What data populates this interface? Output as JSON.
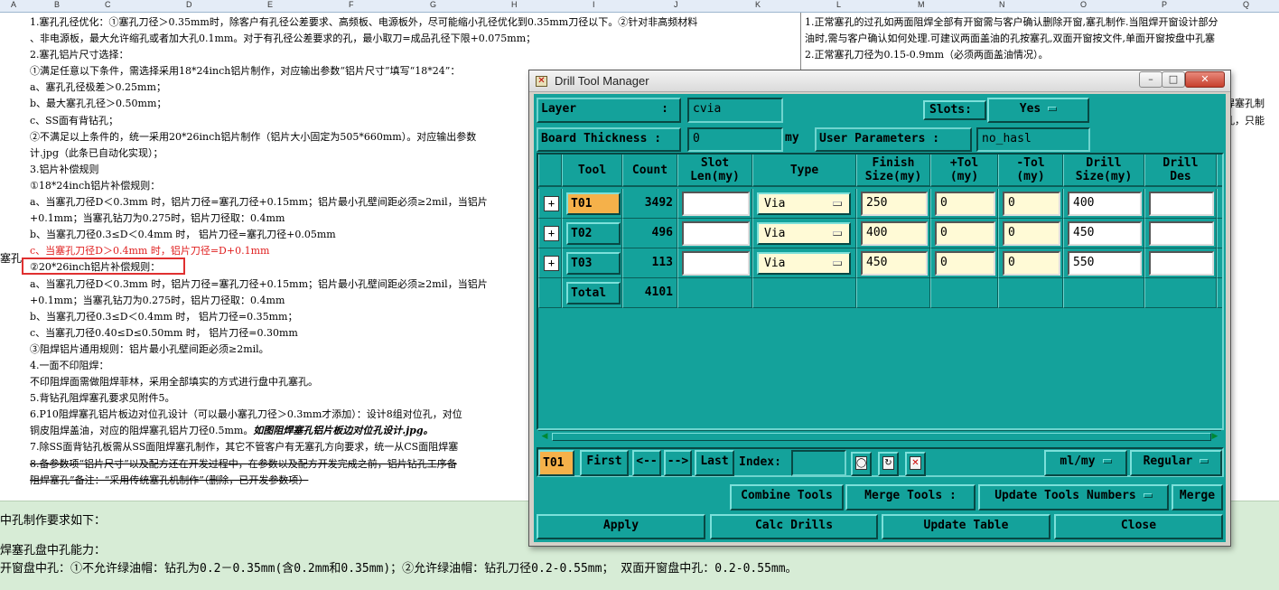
{
  "spreadsheet": {
    "columns": [
      "A",
      "B",
      "C",
      "D",
      "E",
      "F",
      "G",
      "H",
      "I",
      "J",
      "K",
      "L",
      "M",
      "N",
      "O",
      "P",
      "Q"
    ],
    "row_label": "塞孔",
    "left_cell": [
      {
        "text": "1.塞孔孔径优化：①塞孔刀径＞0.35mm时，除客户有孔径公差要求、高频板、电源板外，尽可能缩小孔径优化到0.35mm刀径以下。②针对非高频材料",
        "style": ""
      },
      {
        "text": "、非电源板，最大允许缩孔或者加大孔0.1mm。对于有孔径公差要求的孔，最小取刀=成品孔径下限+0.075mm；",
        "style": ""
      },
      {
        "text": "2.塞孔铝片尺寸选择：",
        "style": ""
      },
      {
        "text": "①满足任意以下条件，需选择采用18*24inch铝片制作，对应输出参数“铝片尺寸”填写“18*24”：",
        "style": ""
      },
      {
        "text": "a、塞孔孔径极差＞0.25mm；",
        "style": ""
      },
      {
        "text": "b、最大塞孔孔径＞0.50mm；",
        "style": ""
      },
      {
        "text": "c、SS面有背钻孔；",
        "style": ""
      },
      {
        "text": "②不满足以上条件的，统一采用20*26inch铝片制作（铝片大小固定为505*660mm）。对应输出参数",
        "style": ""
      },
      {
        "text": "计.jpg（此条已自动化实现）；",
        "style": ""
      },
      {
        "text": "3.铝片补偿规则",
        "style": ""
      },
      {
        "text": "①18*24inch铝片补偿规则：",
        "style": ""
      },
      {
        "text": "a、当塞孔刀径D＜0.3mm 时，铝片刀径=塞孔刀径+0.15mm；铝片最小孔壁间距必须≥2mil，当铝片",
        "style": ""
      },
      {
        "text": "+0.1mm；当塞孔钻刀为0.275时，铝片刀径取：0.4mm",
        "style": ""
      },
      {
        "text": "b、当塞孔刀径0.3≤D＜0.4mm 时， 铝片刀径=塞孔刀径+0.05mm",
        "style": ""
      },
      {
        "text": "c、当塞孔刀径D＞0.4mm 时，铝片刀径=D+0.1mm",
        "style": "red"
      },
      {
        "text": "②20*26inch铝片补偿规则：",
        "style": ""
      },
      {
        "text": "a、当塞孔刀径D＜0.3mm 时，铝片刀径=塞孔刀径+0.15mm；铝片最小孔壁间距必须≥2mil，当铝片",
        "style": ""
      },
      {
        "text": "+0.1mm；当塞孔钻刀为0.275时，铝片刀径取：0.4mm",
        "style": ""
      },
      {
        "text": "b、当塞孔刀径0.3≤D＜0.4mm 时， 铝片刀径=0.35mm；",
        "style": ""
      },
      {
        "text": "c、当塞孔刀径0.40≤D≤0.50mm 时， 铝片刀径=0.30mm",
        "style": ""
      },
      {
        "text": "③阻焊铝片通用规则：铝片最小孔壁间距必须≥2mil。",
        "style": ""
      },
      {
        "text": "4.一面不印阻焊：",
        "style": ""
      },
      {
        "text": "不印阻焊面需做阻焊菲林，采用全部填实的方式进行盘中孔塞孔。",
        "style": ""
      },
      {
        "text": "5.背钻孔阻焊塞孔要求见附件5。",
        "style": ""
      },
      {
        "text": "6.P10阻焊塞孔铝片板边对位孔设计（可以最小塞孔刀径＞0.3mm才添加）：设计8组对位孔，对位",
        "style": ""
      },
      {
        "text": "铜皮阻焊盖油，对应的阻焊塞孔铝片刀径0.5mm。",
        "style": "",
        "emphasis": "如图阻焊塞孔铝片板边对位孔设计.jpg。"
      },
      {
        "text": "7.除SS面背钻孔板需从SS面阻焊塞孔制作，其它不管客户有无塞孔方向要求，统一从CS面阻焊塞",
        "style": ""
      },
      {
        "text": "8.备参数项“铝片尺寸”以及配方还在开发过程中，在参数以及配方开发完成之前，铝片钻孔工序备",
        "style": "strike"
      },
      {
        "text": "阻焊塞孔”备注：“采用传统塞孔机制作”（删除，已开发参数项）",
        "style": "strike"
      }
    ],
    "right_cell": [
      "1.正常塞孔的过孔如两面阻焊全部有开窗需与客户确认删除开窗,塞孔制作.当阻焊开窗设计部分",
      "油时,需与客户确认如何处理.可建议两面盖油的孔按塞孔,双面开窗按文件,单面开窗按盘中孔塞",
      "2.正常塞孔刀径为0.15-0.9mm（必须两面盖油情况）。",
      "",
      "",
      "焊塞孔制",
      "孔，只能"
    ],
    "bottom_lines": [
      "中孔制作要求如下：",
      "焊塞孔盘中孔能力：",
      "开窗盘中孔：①不允许绿油帽：钻孔为0.2－0.35mm(含0.2mm和0.35mm)；②允许绿油帽：钻孔刀径0.2-0.55mm；     双面开窗盘中孔：0.2-0.55mm。"
    ]
  },
  "dialog": {
    "title": "Drill Tool Manager",
    "window_buttons": {
      "minimize": "–",
      "maximize": "□",
      "close": "✕"
    },
    "layer_label": "Layer",
    "layer_colon": ":",
    "layer_value": "cvia",
    "slots_label": "Slots:",
    "slots_value": "Yes",
    "board_thickness_label": "Board Thickness :",
    "board_thickness_value": "0",
    "board_thickness_unit": "my",
    "user_params_label": "User Parameters :",
    "user_params_value": "no_hasl",
    "columns": [
      "Tool",
      "Count",
      "Slot\nLen(my)",
      "Type",
      "Finish\nSize(my)",
      "+Tol\n(my)",
      "-Tol\n(my)",
      "Drill\nSize(my)",
      "Drill\nDes",
      "S"
    ],
    "rows": [
      {
        "tool": "T01",
        "count": "3492",
        "slot_len": "",
        "type": "Via",
        "finish": "250",
        "plus_tol": "0",
        "minus_tol": "0",
        "drill": "400",
        "des": "",
        "selected": true
      },
      {
        "tool": "T02",
        "count": "496",
        "slot_len": "",
        "type": "Via",
        "finish": "400",
        "plus_tol": "0",
        "minus_tol": "0",
        "drill": "450",
        "des": "",
        "selected": false
      },
      {
        "tool": "T03",
        "count": "113",
        "slot_len": "",
        "type": "Via",
        "finish": "450",
        "plus_tol": "0",
        "minus_tol": "0",
        "drill": "550",
        "des": "",
        "selected": false
      }
    ],
    "total_label": "Total",
    "total_count": "4101",
    "nav": {
      "current": "T01",
      "first": "First",
      "prev": "<--",
      "next": "-->",
      "last": "Last",
      "index_label": "Index:",
      "index_value": "",
      "units": "ml/my",
      "mode": "Regular"
    },
    "tools_row": {
      "combine": "Combine Tools",
      "merge_tools": "Merge Tools :",
      "update_numbers": "Update Tools Numbers",
      "merge": "Merge"
    },
    "actions": {
      "apply": "Apply",
      "calc": "Calc Drills",
      "update": "Update Table",
      "close": "Close"
    }
  }
}
